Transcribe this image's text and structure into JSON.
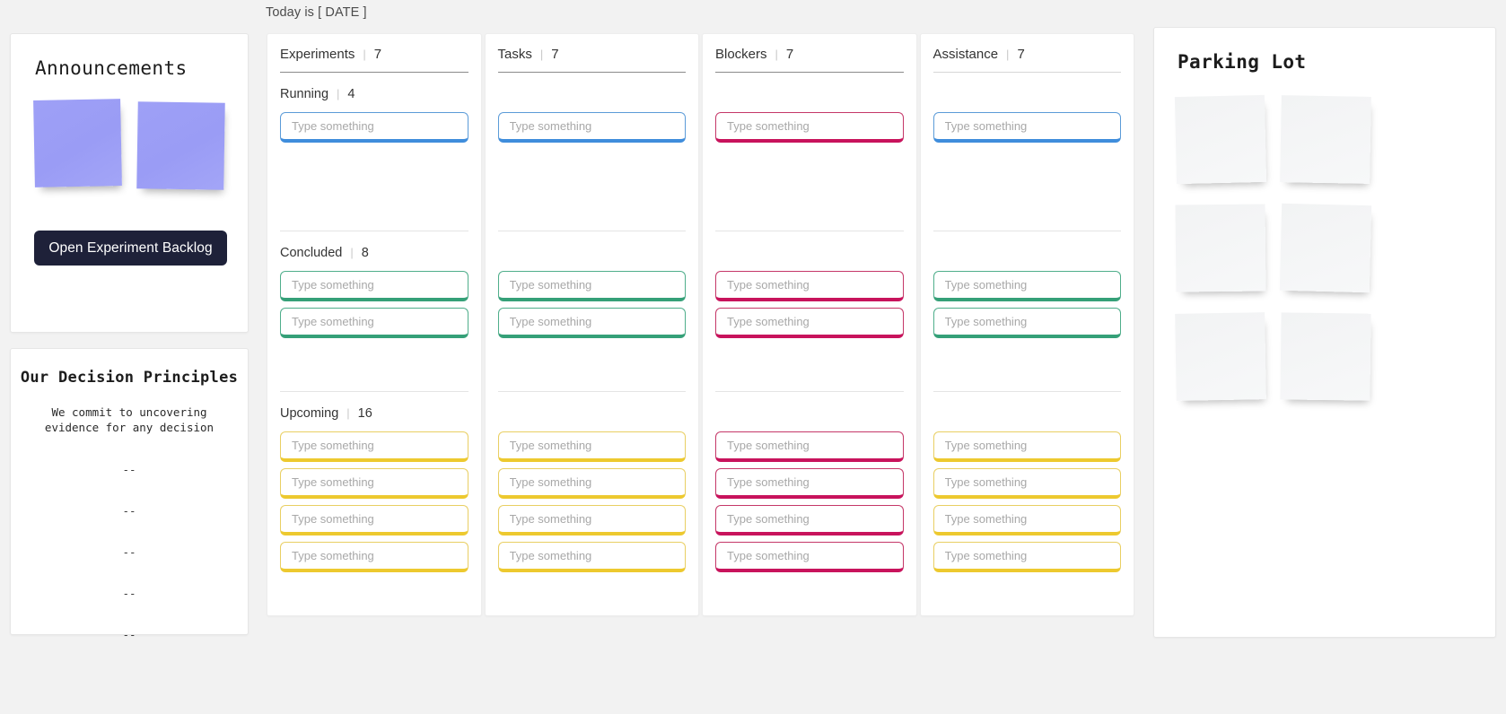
{
  "header": {
    "date_text": "Today is [ DATE ]"
  },
  "announcements": {
    "title": "Announcements",
    "notes": [
      {
        "name": "announcement-note-1",
        "color": "#9a9cf5",
        "text": ""
      },
      {
        "name": "announcement-note-2",
        "color": "#9a9cf5",
        "text": ""
      }
    ],
    "backlog_button": "Open Experiment Backlog"
  },
  "principles": {
    "title": "Our Decision Principles",
    "body_line_1": "We commit to uncovering",
    "body_line_2": "evidence for any decision",
    "items": [
      "--",
      "--",
      "--",
      "--",
      "--"
    ]
  },
  "board": {
    "placeholder": "Type something",
    "columns": [
      {
        "name": "experiments",
        "title": "Experiments",
        "count": "7",
        "rule_color": "#8a8a8a",
        "sections": [
          {
            "name": "running",
            "title": "Running",
            "count": "4",
            "show_title": true,
            "color": "blue",
            "slots": 1
          },
          {
            "name": "concluded",
            "title": "Concluded",
            "count": "8",
            "show_title": true,
            "color": "green",
            "slots": 2
          },
          {
            "name": "upcoming",
            "title": "Upcoming",
            "count": "16",
            "show_title": true,
            "color": "yellow",
            "slots": 4
          }
        ]
      },
      {
        "name": "tasks",
        "title": "Tasks",
        "count": "7",
        "rule_color": "#8a8a8a",
        "sections": [
          {
            "name": "running",
            "title": "",
            "count": "",
            "show_title": false,
            "color": "blue",
            "slots": 1
          },
          {
            "name": "concluded",
            "title": "",
            "count": "",
            "show_title": false,
            "color": "green",
            "slots": 2
          },
          {
            "name": "upcoming",
            "title": "",
            "count": "",
            "show_title": false,
            "color": "yellow",
            "slots": 4
          }
        ]
      },
      {
        "name": "blockers",
        "title": "Blockers",
        "count": "7",
        "rule_color": "#8a8a8a",
        "sections": [
          {
            "name": "running",
            "title": "",
            "count": "",
            "show_title": false,
            "color": "pink",
            "slots": 1
          },
          {
            "name": "concluded",
            "title": "",
            "count": "",
            "show_title": false,
            "color": "pink",
            "slots": 2
          },
          {
            "name": "upcoming",
            "title": "",
            "count": "",
            "show_title": false,
            "color": "pink",
            "slots": 4
          }
        ]
      },
      {
        "name": "assistance",
        "title": "Assistance",
        "count": "7",
        "rule_color": "#d6d6d6",
        "sections": [
          {
            "name": "running",
            "title": "",
            "count": "",
            "show_title": false,
            "color": "blue",
            "slots": 1
          },
          {
            "name": "concluded",
            "title": "",
            "count": "",
            "show_title": false,
            "color": "green",
            "slots": 2
          },
          {
            "name": "upcoming",
            "title": "",
            "count": "",
            "show_title": false,
            "color": "yellow",
            "slots": 4
          }
        ]
      }
    ]
  },
  "parking_lot": {
    "title": "Parking Lot",
    "notes": [
      {
        "name": "parking-note-1",
        "text": ""
      },
      {
        "name": "parking-note-2",
        "text": ""
      },
      {
        "name": "parking-note-3",
        "text": ""
      },
      {
        "name": "parking-note-4",
        "text": ""
      },
      {
        "name": "parking-note-5",
        "text": ""
      },
      {
        "name": "parking-note-6",
        "text": ""
      }
    ]
  },
  "colors": {
    "page_background": "#f2f2f2",
    "card_background": "#ffffff",
    "accent_blue": "#3f8ddc",
    "accent_green": "#35a078",
    "accent_yellow": "#edc92f",
    "accent_pink": "#c8135c",
    "button_dark": "#1e2139",
    "sticky_blue": "#9a9cf5",
    "sticky_gray": "#f4f5f6"
  },
  "divider_pipe": "|"
}
